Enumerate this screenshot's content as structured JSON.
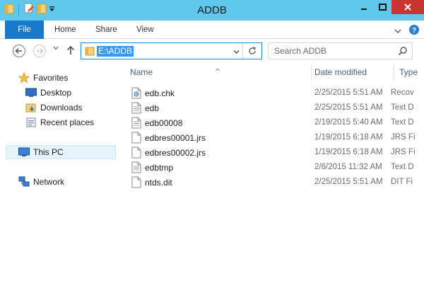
{
  "window": {
    "title": "ADDB"
  },
  "ribbon": {
    "tabs": [
      {
        "label": "File"
      },
      {
        "label": "Home"
      },
      {
        "label": "Share"
      },
      {
        "label": "View"
      }
    ]
  },
  "address": {
    "path": "E:\\ADDB"
  },
  "search": {
    "placeholder": "Search ADDB"
  },
  "navpane": {
    "favorites": "Favorites",
    "desktop": "Desktop",
    "downloads": "Downloads",
    "recent": "Recent places",
    "thispc": "This PC",
    "network": "Network"
  },
  "columns": {
    "name": "Name",
    "date": "Date modified",
    "type": "Type"
  },
  "files": [
    {
      "name": "edb.chk",
      "date": "2/25/2015 5:51 AM",
      "type": "Recov",
      "icon": "chk-file-icon"
    },
    {
      "name": "edb",
      "date": "2/25/2015 5:51 AM",
      "type": "Text D",
      "icon": "text-file-icon"
    },
    {
      "name": "edb00008",
      "date": "2/19/2015 5:40 AM",
      "type": "Text D",
      "icon": "text-file-icon"
    },
    {
      "name": "edbres00001.jrs",
      "date": "1/19/2015 6:18 AM",
      "type": "JRS Fi",
      "icon": "file-icon"
    },
    {
      "name": "edbres00002.jrs",
      "date": "1/19/2015 6:18 AM",
      "type": "JRS Fi",
      "icon": "file-icon"
    },
    {
      "name": "edbtmp",
      "date": "2/6/2015 11:32 AM",
      "type": "Text D",
      "icon": "text-file-icon"
    },
    {
      "name": "ntds.dit",
      "date": "2/25/2015 5:51 AM",
      "type": "DIT Fi",
      "icon": "file-icon"
    }
  ],
  "colors": {
    "titlebar": "#60c8eb",
    "file_tab": "#1979ca",
    "close": "#c7372f",
    "selection": "#3399ff"
  }
}
